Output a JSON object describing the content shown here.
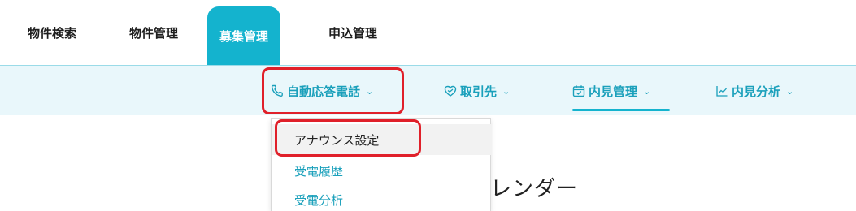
{
  "topnav": {
    "tabs": [
      {
        "label": "物件検索",
        "active": false
      },
      {
        "label": "物件管理",
        "active": false
      },
      {
        "label": "募集管理",
        "active": true
      },
      {
        "label": "申込管理",
        "active": false
      }
    ]
  },
  "subnav": {
    "items": [
      {
        "label": "自動応答電話",
        "icon": "phone-icon"
      },
      {
        "label": "取引先",
        "icon": "handshake-heart-icon"
      },
      {
        "label": "内見管理",
        "icon": "calendar-check-icon",
        "active": true
      },
      {
        "label": "内見分析",
        "icon": "line-chart-icon"
      }
    ]
  },
  "dropdown": {
    "items": [
      {
        "label": "アナウンス設定"
      },
      {
        "label": "受電履歴"
      },
      {
        "label": "受電分析"
      }
    ]
  },
  "main": {
    "title_fragment": "レンダー"
  },
  "colors": {
    "brand": "#14b3ce",
    "link": "#1aa0bb",
    "subnav_bg": "#e9f7fb",
    "highlight": "#e0202a"
  }
}
